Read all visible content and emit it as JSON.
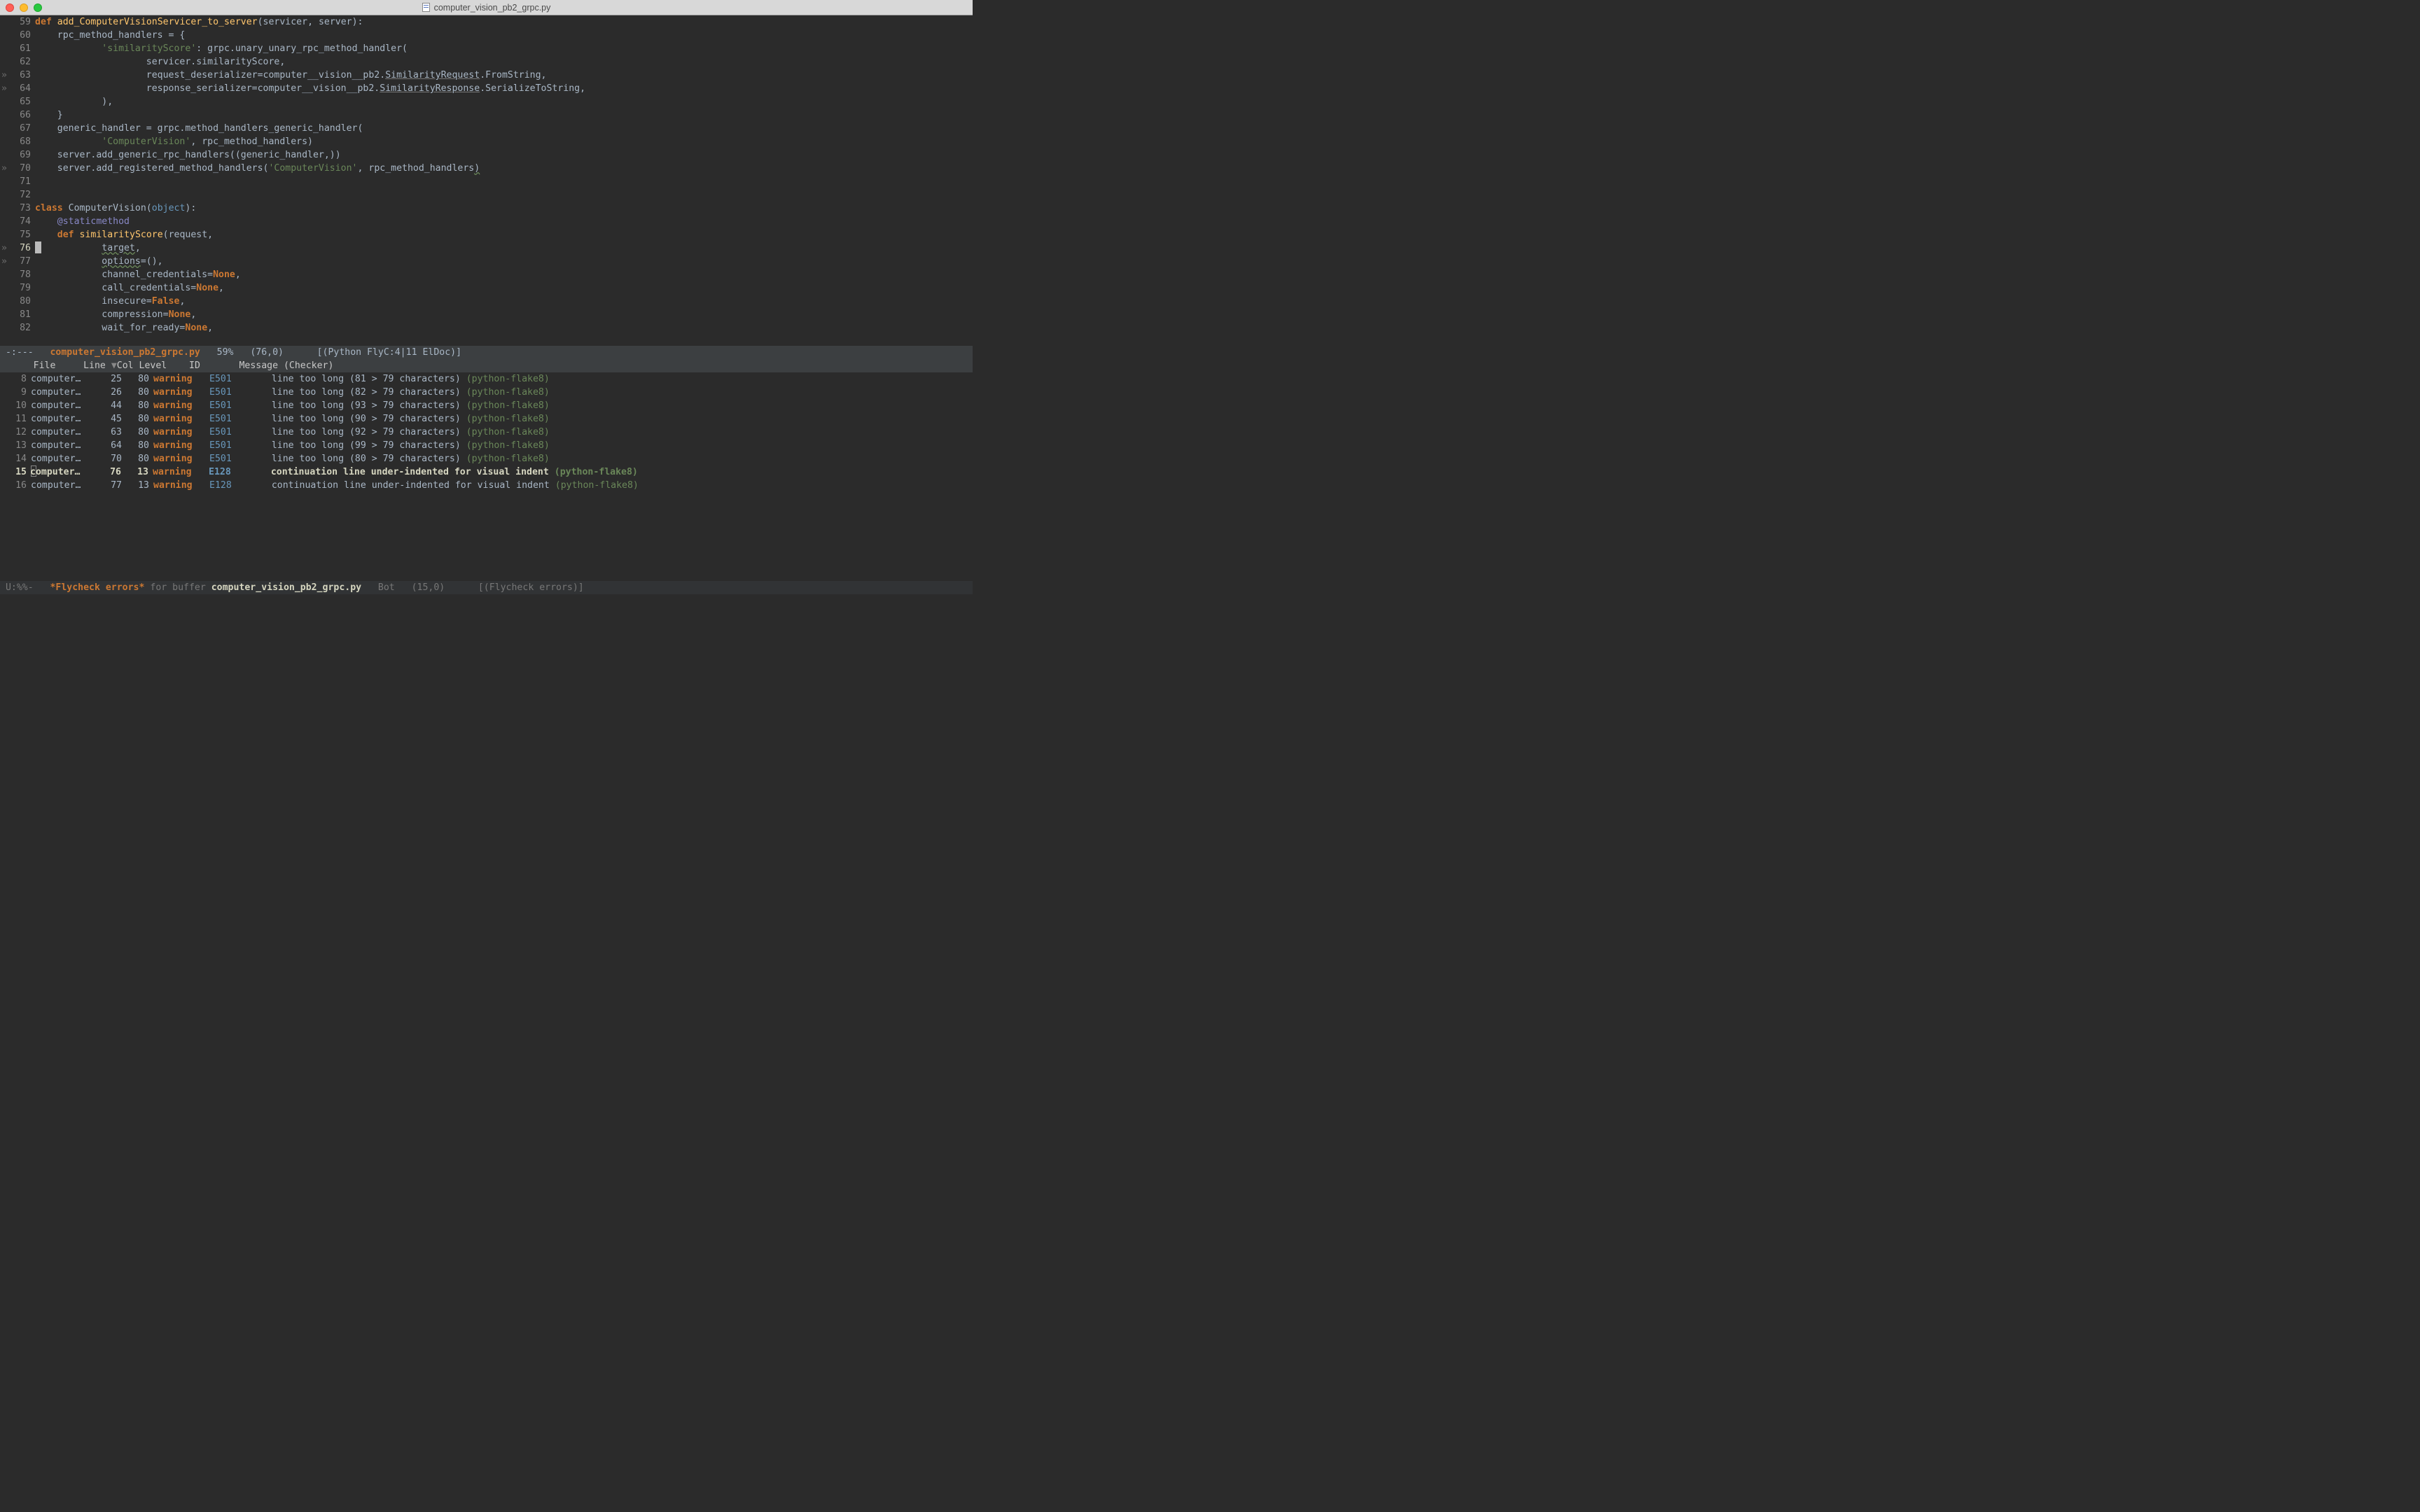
{
  "window": {
    "title": "computer_vision_pb2_grpc.py"
  },
  "modeline_top": {
    "left": " -:---   ",
    "file": "computer_vision_pb2_grpc.py",
    "pct": "   59%   ",
    "pos": "(76,0)      ",
    "mode": "[(Python FlyC:4|11 ElDoc)]"
  },
  "modeline_bot": {
    "left": " U:%%-   ",
    "star_name": "*Flycheck errors*",
    "mid": " for buffer ",
    "file": "computer_vision_pb2_grpc.py",
    "pct": "   Bot   ",
    "pos": "(15,0)      ",
    "mode": "[(Flycheck errors)]"
  },
  "code_lines": [
    {
      "n": 59,
      "fringe": " ",
      "seg": [
        [
          "kw",
          "def"
        ],
        [
          "",
          " "
        ],
        [
          "fn",
          "add_ComputerVisionServicer_to_server"
        ],
        [
          "",
          "(servicer, server):"
        ]
      ]
    },
    {
      "n": 60,
      "fringe": " ",
      "seg": [
        [
          "",
          "    rpc_method_handlers = {"
        ]
      ]
    },
    {
      "n": 61,
      "fringe": " ",
      "seg": [
        [
          "",
          "            "
        ],
        [
          "str",
          "'similarityScore'"
        ],
        [
          "",
          ": grpc.unary_unary_rpc_method_handler("
        ]
      ]
    },
    {
      "n": 62,
      "fringe": " ",
      "seg": [
        [
          "",
          "                    servicer.similarityScore,"
        ]
      ]
    },
    {
      "n": 63,
      "fringe": "»",
      "seg": [
        [
          "",
          "                    request_deserializer=computer__vision__pb2."
        ],
        [
          "u",
          "SimilarityRequest"
        ],
        [
          "",
          ".FromString,"
        ]
      ]
    },
    {
      "n": 64,
      "fringe": "»",
      "seg": [
        [
          "",
          "                    response_serializer=computer__vision__pb2."
        ],
        [
          "u",
          "SimilarityResponse"
        ],
        [
          "",
          ".SerializeToString,"
        ]
      ]
    },
    {
      "n": 65,
      "fringe": " ",
      "seg": [
        [
          "",
          "            ),"
        ]
      ]
    },
    {
      "n": 66,
      "fringe": " ",
      "seg": [
        [
          "",
          "    }"
        ]
      ]
    },
    {
      "n": 67,
      "fringe": " ",
      "seg": [
        [
          "",
          "    generic_handler = grpc.method_handlers_generic_handler("
        ]
      ]
    },
    {
      "n": 68,
      "fringe": " ",
      "seg": [
        [
          "",
          "            "
        ],
        [
          "str",
          "'ComputerVision'"
        ],
        [
          "",
          ", rpc_method_handlers)"
        ]
      ]
    },
    {
      "n": 69,
      "fringe": " ",
      "seg": [
        [
          "",
          "    server.add_generic_rpc_handlers((generic_handler,))"
        ]
      ]
    },
    {
      "n": 70,
      "fringe": "»",
      "seg": [
        [
          "",
          "    server.add_registered_method_handlers("
        ],
        [
          "str",
          "'ComputerVision'"
        ],
        [
          "",
          ", rpc_method_handlers"
        ],
        [
          "warn-u",
          ")"
        ]
      ]
    },
    {
      "n": 71,
      "fringe": " ",
      "seg": [
        [
          "",
          ""
        ]
      ]
    },
    {
      "n": 72,
      "fringe": " ",
      "seg": [
        [
          "",
          ""
        ]
      ]
    },
    {
      "n": 73,
      "fringe": " ",
      "seg": [
        [
          "kw",
          "class"
        ],
        [
          "",
          " "
        ],
        [
          "cls",
          "ComputerVision"
        ],
        [
          "",
          "("
        ],
        [
          "type",
          "object"
        ],
        [
          "",
          "):"
        ]
      ]
    },
    {
      "n": 74,
      "fringe": " ",
      "seg": [
        [
          "",
          "    "
        ],
        [
          "builtin",
          "@staticmethod"
        ]
      ]
    },
    {
      "n": 75,
      "fringe": " ",
      "seg": [
        [
          "",
          "    "
        ],
        [
          "kw",
          "def"
        ],
        [
          "",
          " "
        ],
        [
          "fn",
          "similarityScore"
        ],
        [
          "",
          "(request,"
        ]
      ]
    },
    {
      "n": 76,
      "fringe": "»",
      "cur": true,
      "seg": [
        [
          "",
          "            "
        ],
        [
          "warn-u",
          "target"
        ],
        [
          "",
          ","
        ]
      ]
    },
    {
      "n": 77,
      "fringe": "»",
      "seg": [
        [
          "",
          "            "
        ],
        [
          "warn-u",
          "options"
        ],
        [
          "",
          "=(),"
        ]
      ]
    },
    {
      "n": 78,
      "fringe": " ",
      "seg": [
        [
          "",
          "            channel_credentials="
        ],
        [
          "kw",
          "None"
        ],
        [
          "",
          ","
        ]
      ]
    },
    {
      "n": 79,
      "fringe": " ",
      "seg": [
        [
          "",
          "            call_credentials="
        ],
        [
          "kw",
          "None"
        ],
        [
          "",
          ","
        ]
      ]
    },
    {
      "n": 80,
      "fringe": " ",
      "seg": [
        [
          "",
          "            insecure="
        ],
        [
          "kw",
          "False"
        ],
        [
          "",
          ","
        ]
      ]
    },
    {
      "n": 81,
      "fringe": " ",
      "seg": [
        [
          "",
          "            compression="
        ],
        [
          "kw",
          "None"
        ],
        [
          "",
          ","
        ]
      ]
    },
    {
      "n": 82,
      "fringe": " ",
      "seg": [
        [
          "",
          "            wait_for_ready="
        ],
        [
          "kw",
          "None"
        ],
        [
          "",
          ","
        ]
      ]
    }
  ],
  "fly_header": {
    "pad": "      ",
    "file": "File     ",
    "line": "Line ",
    "tri": "▼",
    "col": "Col ",
    "level": "Level    ",
    "id": "ID       ",
    "msg": "Message (Checker)"
  },
  "fly_rows": [
    {
      "rn": 8,
      "file": "computer…",
      "line": 25,
      "col": 80,
      "lvl": "warning",
      "id": "E501",
      "msg": "line too long (81 > 79 characters)",
      "chk": "python-flake8"
    },
    {
      "rn": 9,
      "file": "computer…",
      "line": 26,
      "col": 80,
      "lvl": "warning",
      "id": "E501",
      "msg": "line too long (82 > 79 characters)",
      "chk": "python-flake8"
    },
    {
      "rn": 10,
      "file": "computer…",
      "line": 44,
      "col": 80,
      "lvl": "warning",
      "id": "E501",
      "msg": "line too long (93 > 79 characters)",
      "chk": "python-flake8"
    },
    {
      "rn": 11,
      "file": "computer…",
      "line": 45,
      "col": 80,
      "lvl": "warning",
      "id": "E501",
      "msg": "line too long (90 > 79 characters)",
      "chk": "python-flake8"
    },
    {
      "rn": 12,
      "file": "computer…",
      "line": 63,
      "col": 80,
      "lvl": "warning",
      "id": "E501",
      "msg": "line too long (92 > 79 characters)",
      "chk": "python-flake8"
    },
    {
      "rn": 13,
      "file": "computer…",
      "line": 64,
      "col": 80,
      "lvl": "warning",
      "id": "E501",
      "msg": "line too long (99 > 79 characters)",
      "chk": "python-flake8"
    },
    {
      "rn": 14,
      "file": "computer…",
      "line": 70,
      "col": 80,
      "lvl": "warning",
      "id": "E501",
      "msg": "line too long (80 > 79 characters)",
      "chk": "python-flake8"
    },
    {
      "rn": 15,
      "sel": true,
      "file": "computer…",
      "line": 76,
      "col": 13,
      "lvl": "warning",
      "id": "E128",
      "msg": "continuation line under-indented for visual indent",
      "chk": "python-flake8"
    },
    {
      "rn": 16,
      "file": "computer…",
      "line": 77,
      "col": 13,
      "lvl": "warning",
      "id": "E128",
      "msg": "continuation line under-indented for visual indent",
      "chk": "python-flake8"
    }
  ]
}
